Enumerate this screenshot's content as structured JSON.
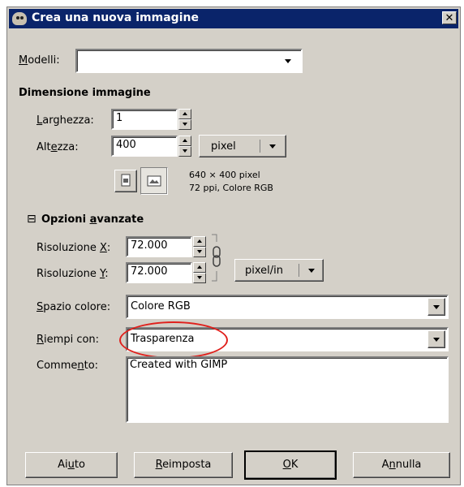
{
  "window": {
    "title": "Crea una nuova immagine",
    "close_glyph": "✕"
  },
  "template": {
    "label_pre": "",
    "label_u": "M",
    "label_post": "odelli:",
    "value": ""
  },
  "image_size": {
    "heading": "Dimensione immagine",
    "width_label_u": "L",
    "width_label_post": "arghezza:",
    "width_value": "1",
    "height_label_pre": "Alt",
    "height_label_u": "e",
    "height_label_post": "zza:",
    "height_value": "400",
    "unit": "pixel",
    "info_line1": "640 × 400 pixel",
    "info_line2": "72 ppi, Colore RGB"
  },
  "advanced": {
    "toggle_glyph": "⊟",
    "heading_pre": "Opzioni ",
    "heading_u": "a",
    "heading_post": "vanzate",
    "xres_label_pre": "Risoluzione ",
    "xres_label_u": "X",
    "xres_label_post": ":",
    "xres_value": "72.000",
    "yres_label_pre": "Risoluzione ",
    "yres_label_u": "Y",
    "yres_label_post": ":",
    "yres_value": "72.000",
    "res_unit": "pixel/in",
    "colorspace_label_u": "S",
    "colorspace_label_post": "pazio colore:",
    "colorspace_value": "Colore RGB",
    "fill_label_u": "R",
    "fill_label_post": "iempi con:",
    "fill_value": "Trasparenza",
    "comment_label_pre": "Comme",
    "comment_label_u": "n",
    "comment_label_post": "to:",
    "comment_value": "Created with GIMP"
  },
  "buttons": {
    "help_pre": "Ai",
    "help_u": "u",
    "help_post": "to",
    "reset_u": "R",
    "reset_post": "eimposta",
    "ok_u": "O",
    "ok_post": "K",
    "cancel_pre": "A",
    "cancel_u": "n",
    "cancel_post": "nulla"
  },
  "highlight_color": "#e0201c"
}
